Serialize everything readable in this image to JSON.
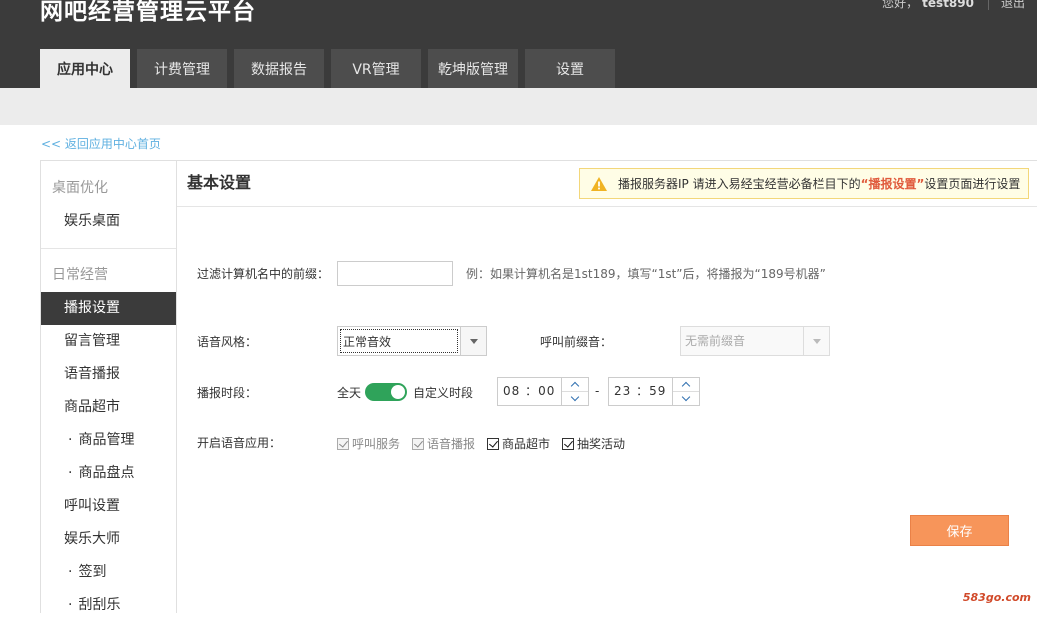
{
  "header": {
    "brand": "网吧经营管理云平台",
    "greeting": "您好，",
    "username": "test890",
    "logout": "退出"
  },
  "tabs": [
    {
      "label": "应用中心",
      "active": true
    },
    {
      "label": "计费管理",
      "active": false
    },
    {
      "label": "数据报告",
      "active": false
    },
    {
      "label": "VR管理",
      "active": false
    },
    {
      "label": "乾坤版管理",
      "active": false
    },
    {
      "label": "设置",
      "active": false
    }
  ],
  "back_link": "<< 返回应用中心首页",
  "sidebar": {
    "group1": "桌面优化",
    "group1_items": [
      "娱乐桌面"
    ],
    "group2": "日常经营",
    "items": {
      "broadcast_settings": "播报设置",
      "message_mgmt": "留言管理",
      "voice_broadcast": "语音播报",
      "goods_market": "商品超市",
      "goods_mgmt": "商品管理",
      "goods_inventory": "商品盘点",
      "call_settings": "呼叫设置",
      "entertainment_master": "娱乐大师",
      "sign_in": "签到",
      "scratch": "刮刮乐"
    },
    "active_item": "播报设置"
  },
  "main": {
    "section_title": "基本设置",
    "notice": {
      "text_before": "播报服务器IP 请进入易经宝经营必备栏目下的",
      "highlight": "“播报设置”",
      "text_after": "设置页面进行设置",
      "icon": "warning-icon"
    },
    "prefix_label": "过滤计算机名中的前缀：",
    "prefix_value": "",
    "prefix_hint": "例：如果计算机名是1st189，填写“1st”后，将播报为“189号机器”",
    "voice_style_label": "语音风格：",
    "voice_style_value": "正常音效",
    "call_prefix_label": "呼叫前缀音：",
    "call_prefix_value": "无需前缀音",
    "period_label": "播报时段：",
    "all_day_label": "全天",
    "custom_period_label": "自定义时段",
    "toggle_on": true,
    "start_time": "08 ：00",
    "time_separator": "-",
    "end_time": "23 ：59",
    "voice_apps_label": "开启语音应用：",
    "voice_apps": [
      {
        "label": "呼叫服务",
        "checked": true,
        "disabled": true
      },
      {
        "label": "语音播报",
        "checked": true,
        "disabled": true
      },
      {
        "label": "商品超市",
        "checked": true,
        "disabled": false
      },
      {
        "label": "抽奖活动",
        "checked": true,
        "disabled": false
      }
    ],
    "save_label": "保存"
  },
  "watermark": "583go.com",
  "colors": {
    "header_bg": "#3b3b3b",
    "toggle_green": "#2fa35a",
    "save_orange": "#f7955a",
    "link_blue": "#5fb0e0",
    "highlight_red": "#e05a3c"
  }
}
